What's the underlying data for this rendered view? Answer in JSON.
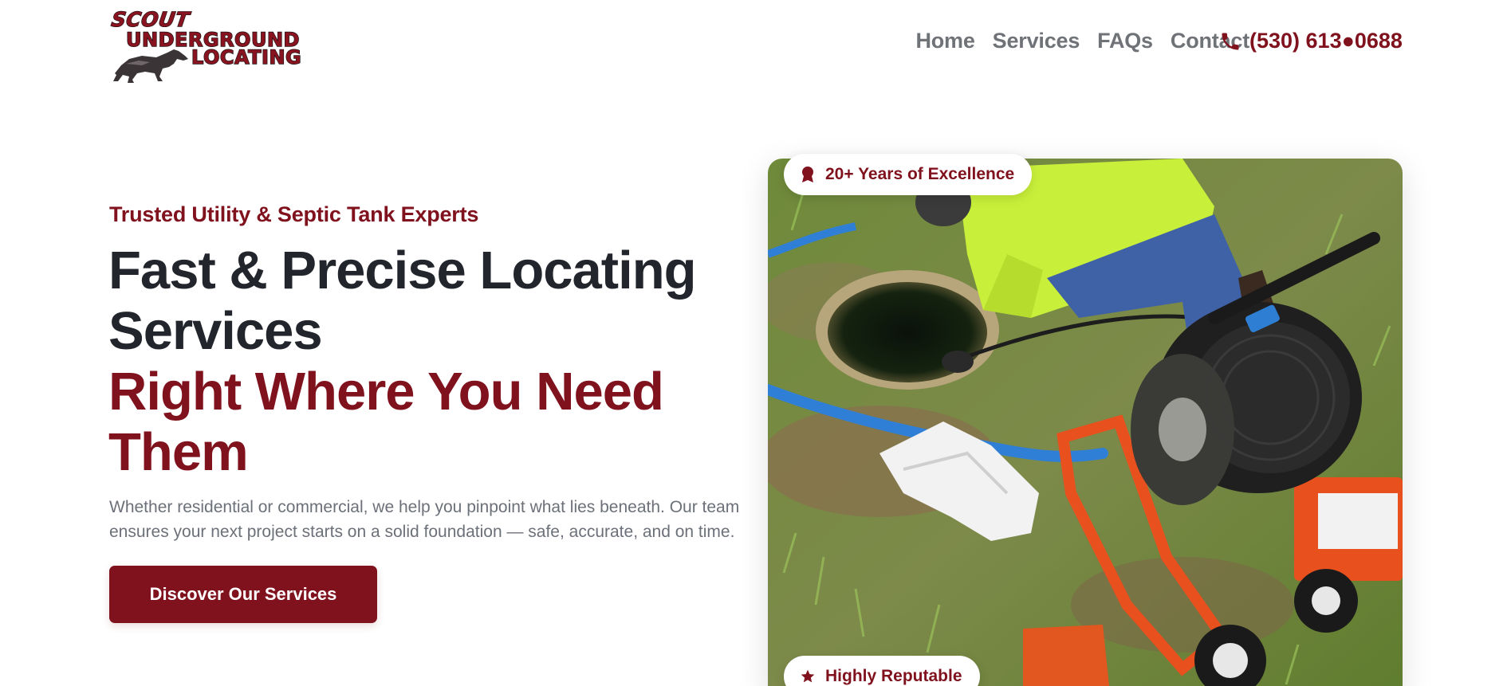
{
  "brand": {
    "logo_top": "SCOUT",
    "logo_middle": "UNDERGROUND",
    "logo_bottom": "LOCATING"
  },
  "nav": {
    "items": [
      {
        "label": "Home"
      },
      {
        "label": "Services"
      },
      {
        "label": "FAQs"
      },
      {
        "label": "Contact"
      }
    ],
    "phone": "(530) 613●0688"
  },
  "hero": {
    "eyebrow": "Trusted Utility & Septic Tank Experts",
    "headline_line1": "Fast & Precise Locating",
    "headline_line2": "Services",
    "headline_accent_line1": "Right Where You Need",
    "headline_accent_line2": "Them",
    "description": "Whether residential or commercial, we help you pinpoint what lies beneath. Our team ensures your next project starts on a solid foundation — safe, accurate, and on time.",
    "cta_label": "Discover Our Services",
    "image_alt": "Technician locating septic line"
  },
  "badges": {
    "years": "20+ Years of Excellence",
    "reputable": "Highly Reputable"
  },
  "colors": {
    "accent": "#80121e",
    "heading": "#22252b",
    "muted": "#6c7078"
  },
  "icons": {
    "phone": "phone-icon",
    "award": "award-icon",
    "star": "star-icon"
  }
}
